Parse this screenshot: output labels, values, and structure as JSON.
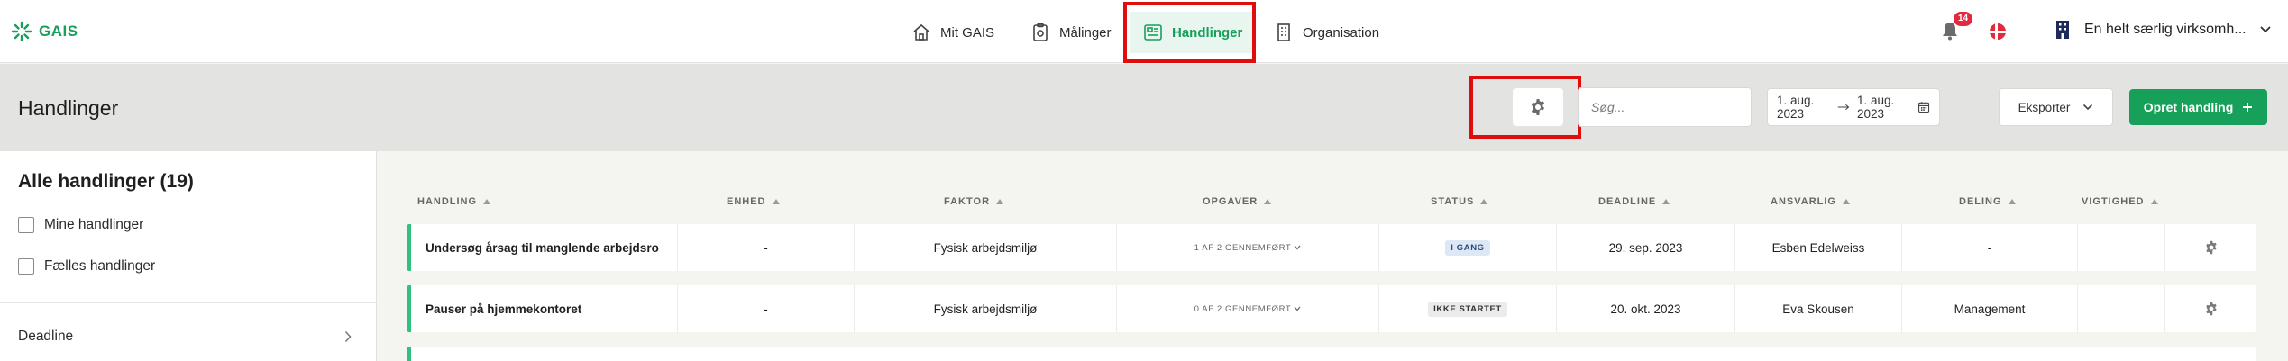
{
  "brand": {
    "logo_text": "GAIS",
    "accent": "#16a05a"
  },
  "nav": {
    "items": [
      {
        "label": "Mit GAIS",
        "icon": "home-icon"
      },
      {
        "label": "Målinger",
        "icon": "clipboard-icon"
      },
      {
        "label": "Handlinger",
        "icon": "dashboard-icon",
        "active": true
      },
      {
        "label": "Organisation",
        "icon": "building-icon"
      }
    ],
    "notifications_count": "14",
    "language_flag": "flag-denmark-icon",
    "organization_name": "En helt særlig virksomh..."
  },
  "header": {
    "title": "Handlinger",
    "search_placeholder": "Søg...",
    "date_from": "1. aug. 2023",
    "date_to": "1. aug. 2023",
    "export_label": "Eksporter",
    "create_label": "Opret handling"
  },
  "sidebar": {
    "title": "Alle handlinger (19)",
    "filters": [
      "Mine handlinger",
      "Fælles handlinger"
    ],
    "deadline_label": "Deadline"
  },
  "table": {
    "columns": [
      "HANDLING",
      "ENHED",
      "FAKTOR",
      "OPGAVER",
      "STATUS",
      "DEADLINE",
      "ANSVARLIG",
      "DELING",
      "VIGTIGHED"
    ],
    "rows": [
      {
        "handling": "Undersøg årsag til manglende arbejdsro",
        "enhed": "-",
        "faktor": "Fysisk arbejdsmiljø",
        "opgaver": "1 AF 2 GENNEMFØRT",
        "status": "I GANG",
        "deadline": "29. sep. 2023",
        "ansvarlig": "Esben Edelweiss",
        "deling": "-",
        "vigtighed": ""
      },
      {
        "handling": "Pauser på hjemmekontoret",
        "enhed": "-",
        "faktor": "Fysisk arbejdsmiljø",
        "opgaver": "0 AF 2 GENNEMFØRT",
        "status": "IKKE STARTET",
        "deadline": "20. okt. 2023",
        "ansvarlig": "Eva Skousen",
        "deling": "Management",
        "vigtighed": ""
      }
    ]
  }
}
